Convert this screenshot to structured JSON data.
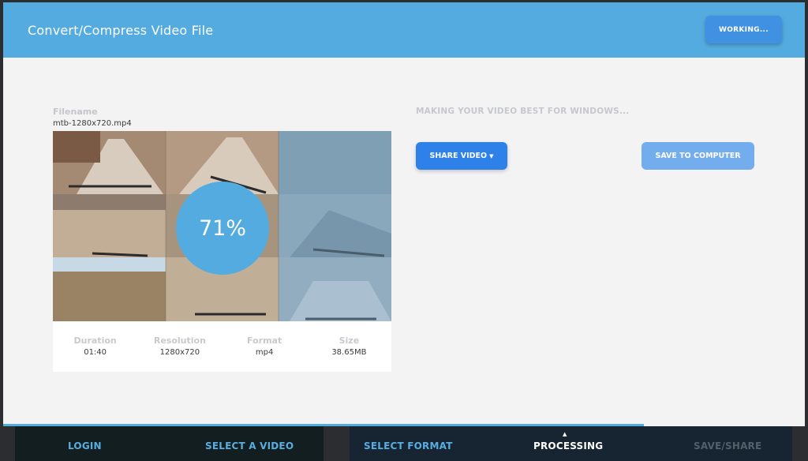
{
  "header": {
    "title": "Convert/Compress Video File",
    "working_button": "WORKING..."
  },
  "video": {
    "filename_label": "Filename",
    "filename": "mtb-1280x720.mp4",
    "progress_text": "71%",
    "progress_fraction": 0.71
  },
  "meta": [
    {
      "label": "Duration",
      "value": "01:40"
    },
    {
      "label": "Resolution",
      "value": "1280x720"
    },
    {
      "label": "Format",
      "value": "mp4"
    },
    {
      "label": "Size",
      "value": "38.65MB"
    }
  ],
  "status_text": "MAKING YOUR VIDEO BEST FOR WINDOWS...",
  "actions": {
    "share_label": "SHARE VIDEO",
    "save_label": "SAVE TO COMPUTER"
  },
  "steps": [
    {
      "label": "LOGIN",
      "state": "done"
    },
    {
      "label": "SELECT A VIDEO",
      "state": "done"
    },
    {
      "label": "SELECT FORMAT",
      "state": "done"
    },
    {
      "label": "PROCESSING",
      "state": "active"
    },
    {
      "label": "SAVE/SHARE",
      "state": "pending"
    }
  ],
  "colors": {
    "header": "#54abdf",
    "primary_button": "#2d81e9",
    "secondary_button": "#74adee",
    "progress": "#54abdf"
  }
}
